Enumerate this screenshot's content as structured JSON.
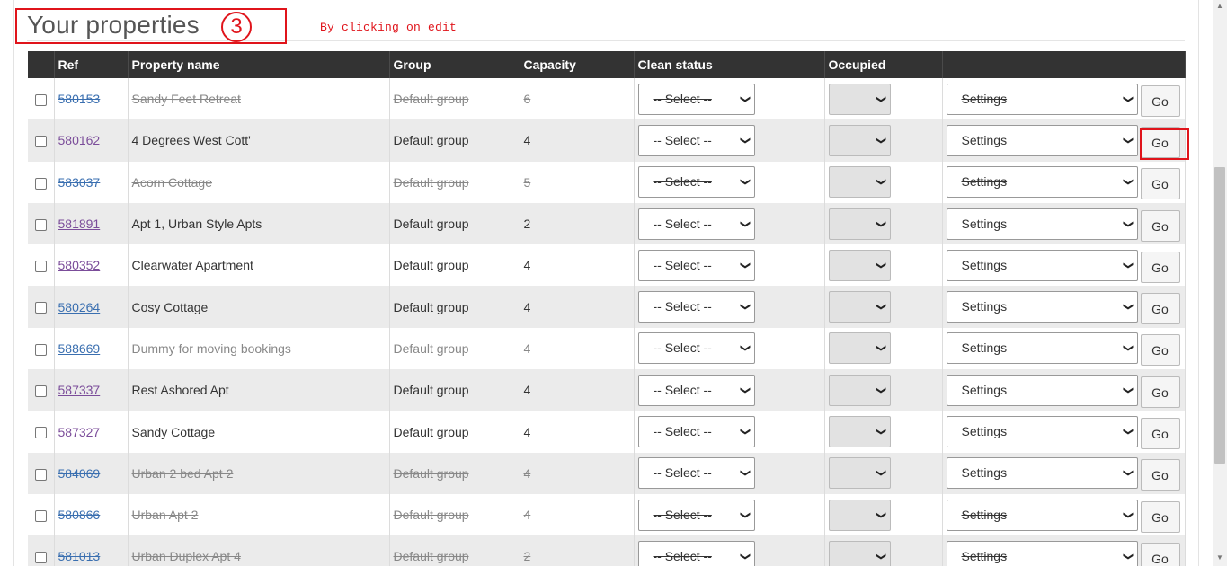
{
  "heading": {
    "title": "Your properties",
    "step_number": "3",
    "note": "By clicking on edit"
  },
  "columns": [
    "Ref",
    "Property name",
    "Group",
    "Capacity",
    "Clean status",
    "Occupied",
    ""
  ],
  "rows": [
    {
      "ref": "580153",
      "name": "Sandy Feet Retreat",
      "group": "Default group",
      "capacity": "6",
      "clean": "-- Select --",
      "settings": "Settings",
      "go": "Go",
      "disabled": true
    },
    {
      "ref": "580162",
      "name": "4 Degrees West Cott'",
      "group": "Default group",
      "capacity": "4",
      "clean": "-- Select --",
      "settings": "Settings",
      "go": "Go",
      "disabled": false
    },
    {
      "ref": "583037",
      "name": "Acorn Cottage",
      "group": "Default group",
      "capacity": "5",
      "clean": "-- Select --",
      "settings": "Settings",
      "go": "Go",
      "disabled": true
    },
    {
      "ref": "581891",
      "name": "Apt 1, Urban Style Apts",
      "group": "Default group",
      "capacity": "2",
      "clean": "-- Select --",
      "settings": "Settings",
      "go": "Go",
      "disabled": false
    },
    {
      "ref": "580352",
      "name": "Clearwater Apartment",
      "group": "Default group",
      "capacity": "4",
      "clean": "-- Select --",
      "settings": "Settings",
      "go": "Go",
      "disabled": false
    },
    {
      "ref": "580264",
      "name": "Cosy Cottage",
      "group": "Default group",
      "capacity": "4",
      "clean": "-- Select --",
      "settings": "Settings",
      "go": "Go",
      "disabled": false
    },
    {
      "ref": "588669",
      "name": "Dummy for moving bookings",
      "group": "Default group",
      "capacity": "4",
      "clean": "-- Select --",
      "settings": "Settings",
      "go": "Go",
      "disabled": false
    },
    {
      "ref": "587337",
      "name": "Rest Ashored Apt",
      "group": "Default group",
      "capacity": "4",
      "clean": "-- Select --",
      "settings": "Settings",
      "go": "Go",
      "disabled": false
    },
    {
      "ref": "587327",
      "name": "Sandy Cottage",
      "group": "Default group",
      "capacity": "4",
      "clean": "-- Select --",
      "settings": "Settings",
      "go": "Go",
      "disabled": false
    },
    {
      "ref": "584069",
      "name": "Urban 2 bed Apt 2",
      "group": "Default group",
      "capacity": "4",
      "clean": "-- Select --",
      "settings": "Settings",
      "go": "Go",
      "disabled": true
    },
    {
      "ref": "580866",
      "name": "Urban Apt 2",
      "group": "Default group",
      "capacity": "4",
      "clean": "-- Select --",
      "settings": "Settings",
      "go": "Go",
      "disabled": true
    },
    {
      "ref": "581013",
      "name": "Urban Duplex Apt 4",
      "group": "Default group",
      "capacity": "2",
      "clean": "-- Select --",
      "settings": "Settings",
      "go": "Go",
      "disabled": true
    }
  ],
  "colors": {
    "highlight": "#e0141b",
    "header_bg": "#333333",
    "link": "#3a6fb0",
    "visited_link": "#7b4d9a"
  },
  "icons": {
    "select_arrow": "chevron-down-icon",
    "scroll_up": "scroll-up-arrow-icon",
    "scroll_down": "scroll-down-arrow-icon"
  }
}
